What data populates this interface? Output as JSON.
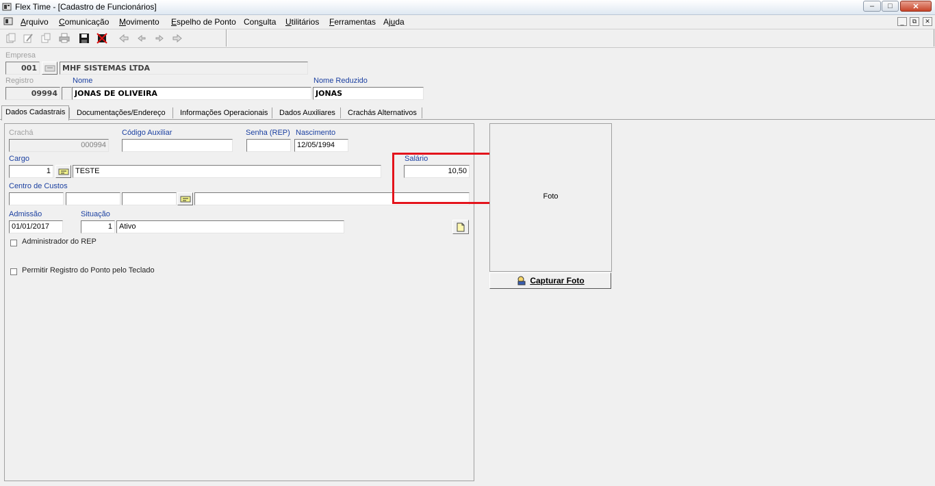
{
  "window": {
    "title": "Flex Time - [Cadastro de Funcionários]"
  },
  "menu": {
    "items": [
      {
        "pre": "",
        "u": "A",
        "post": "rquivo"
      },
      {
        "pre": "",
        "u": "C",
        "post": "omunicação"
      },
      {
        "pre": "",
        "u": "M",
        "post": "ovimento"
      },
      {
        "pre": "",
        "u": "E",
        "post": "spelho de Ponto"
      },
      {
        "pre": "Con",
        "u": "s",
        "post": "ulta"
      },
      {
        "pre": "",
        "u": "U",
        "post": "tilitários"
      },
      {
        "pre": "",
        "u": "F",
        "post": "erramentas"
      },
      {
        "pre": "Aj",
        "u": "u",
        "post": "da"
      }
    ]
  },
  "header": {
    "empresa_label": "Empresa",
    "empresa_code": "001",
    "empresa_name": "MHF SISTEMAS LTDA",
    "registro_label": "Registro",
    "registro_value": "09994",
    "nome_label": "Nome",
    "nome_value": "JONAS DE OLIVEIRA",
    "nome_reduzido_label": "Nome Reduzido",
    "nome_reduzido_value": "JONAS"
  },
  "tabs": [
    "Dados Cadastrais",
    "Documentações/Endereço",
    "Informações Operacionais",
    "Dados Auxiliares",
    "Crachás Alternativos"
  ],
  "form": {
    "cracha_label": "Crachá",
    "cracha_value": "000994",
    "codigo_auxiliar_label": "Código Auxiliar",
    "codigo_auxiliar_value": "",
    "senha_label": "Senha (REP)",
    "senha_value": "",
    "nascimento_label": "Nascimento",
    "nascimento_value": "12/05/1994",
    "cargo_label": "Cargo",
    "cargo_code": "1",
    "cargo_name": "TESTE",
    "salario_label": "Salário",
    "salario_value": "10,50",
    "centro_custos_label": "Centro de Custos",
    "admissao_label": "Admissão",
    "admissao_value": "01/01/2017",
    "situacao_label": "Situação",
    "situacao_code": "1",
    "situacao_name": "Ativo",
    "admin_rep_label": "Administrador do REP",
    "permitir_teclado_label": "Permitir Registro do Ponto pelo Teclado"
  },
  "photo": {
    "placeholder": "Foto",
    "capture_button": "Capturar Foto"
  },
  "colors": {
    "highlight": "#e3131b",
    "label_blue": "#1a3fa0"
  }
}
